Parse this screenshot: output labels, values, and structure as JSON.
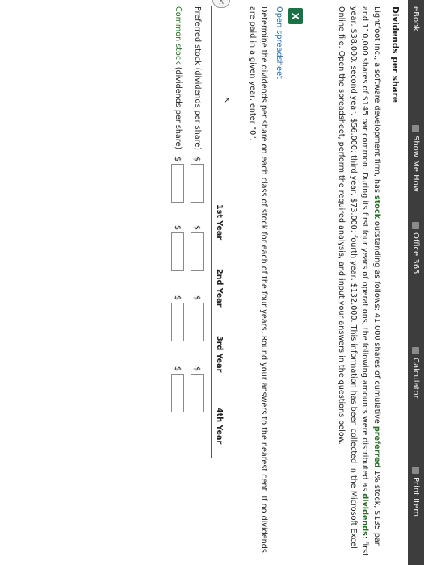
{
  "toolbar": {
    "ebook": "eBook",
    "show_me_how": "Show Me How",
    "office365": "Office 365",
    "calculator": "Calculator",
    "print_item": "Print Item"
  },
  "problem": {
    "title": "Dividends per share",
    "intro_a": "Lightfoot Inc., a software development firm, has ",
    "kw_stock": "stock",
    "intro_b": " outstanding as follows: 41,000 shares of cumulative ",
    "kw_preferred": "preferred",
    "intro_c": " 1% stock, $135 par and 110,000 shares of $145 par common. During its first four years of operations, the following amounts were distributed as ",
    "kw_dividends": "dividends",
    "intro_d": ": first year, $38,000; second year, $56,000; third year, $73,000; fourth year, $132,000. This information has been collected in the Microsoft Excel Online file. Open the spreadsheet, perform the required analysis, and input your answers in the questions below.",
    "excel_icon": "X",
    "open_spreadsheet": "Open spreadsheet",
    "instructions": "Determine the dividends per share on each class of stock for each of the four years. Round your answers to the nearest cent. If no dividends are paid in a given year, enter \"0\"."
  },
  "table": {
    "headers": [
      "1st Year",
      "2nd Year",
      "3rd Year",
      "4th Year"
    ],
    "currency": "$",
    "rows": [
      {
        "label": "Preferred stock (dividends per share)",
        "values": [
          "",
          "",
          "",
          ""
        ]
      },
      {
        "label_link": "Common stock",
        "label_rest": " (dividends per share)",
        "values": [
          "",
          "",
          "",
          ""
        ]
      }
    ]
  },
  "side_tab": {
    "icon": "chevron-left-icon",
    "glyph": "<"
  }
}
